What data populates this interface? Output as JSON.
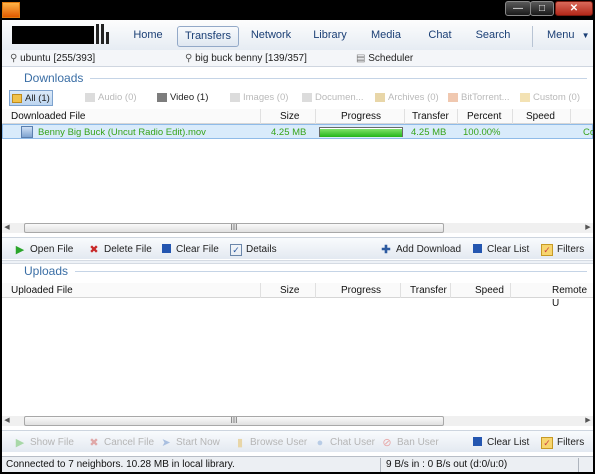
{
  "nav": {
    "tabs": [
      "Home",
      "Transfers",
      "Network",
      "Library",
      "Media",
      "Chat",
      "Search"
    ],
    "active": "Transfers",
    "menu_label": "Menu"
  },
  "search_tabs": [
    {
      "label": "ubuntu [255/393]",
      "icon": "magnifier-icon"
    },
    {
      "label": "big buck benny [139/357]",
      "icon": "magnifier-icon"
    },
    {
      "label": "Scheduler",
      "icon": "scheduler-icon"
    }
  ],
  "downloads": {
    "title": "Downloads",
    "filters": [
      {
        "label": "All (1)",
        "state": "active"
      },
      {
        "label": "Audio (0)",
        "state": "disabled"
      },
      {
        "label": "Video (1)",
        "state": "enabled"
      },
      {
        "label": "Images (0)",
        "state": "disabled"
      },
      {
        "label": "Documen...",
        "state": "disabled"
      },
      {
        "label": "Archives (0)",
        "state": "disabled"
      },
      {
        "label": "BitTorrent...",
        "state": "disabled"
      },
      {
        "label": "Custom (0)",
        "state": "disabled"
      }
    ],
    "columns": [
      "Downloaded File",
      "Size",
      "Progress",
      "Transfer",
      "Percent",
      "Speed"
    ],
    "rows": [
      {
        "file": "Benny Big Buck  (Uncut Radio Edit).mov",
        "size": "4.25 MB",
        "progress": 1.0,
        "transfer": "4.25 MB",
        "percent": "100.00%",
        "speed": "",
        "extra": "Co"
      }
    ],
    "scroll_grip": "III",
    "actions": {
      "open_file": "Open File",
      "delete_file": "Delete File",
      "clear_file": "Clear File",
      "details": "Details",
      "add_download": "Add Download",
      "clear_list": "Clear List",
      "filters": "Filters"
    }
  },
  "uploads": {
    "title": "Uploads",
    "columns": [
      "Uploaded File",
      "Size",
      "Progress",
      "Transfer",
      "Speed",
      "Remote U"
    ],
    "scroll_grip": "III",
    "actions": {
      "show_file": "Show File",
      "cancel_file": "Cancel File",
      "start_now": "Start Now",
      "browse_user": "Browse User",
      "chat_user": "Chat User",
      "ban_user": "Ban User",
      "clear_list": "Clear List",
      "filters": "Filters"
    }
  },
  "status": {
    "connection": "Connected to 7 neighbors.  10.28 MB in local library.",
    "bandwidth": "9 B/s in : 0 B/s out  (d:0/u:0)"
  },
  "colors": {
    "accent": "#3a6ea5",
    "complete_text": "#37a41a",
    "progress_fill": "#22b51a",
    "selected_row": "#d9ebfb"
  }
}
